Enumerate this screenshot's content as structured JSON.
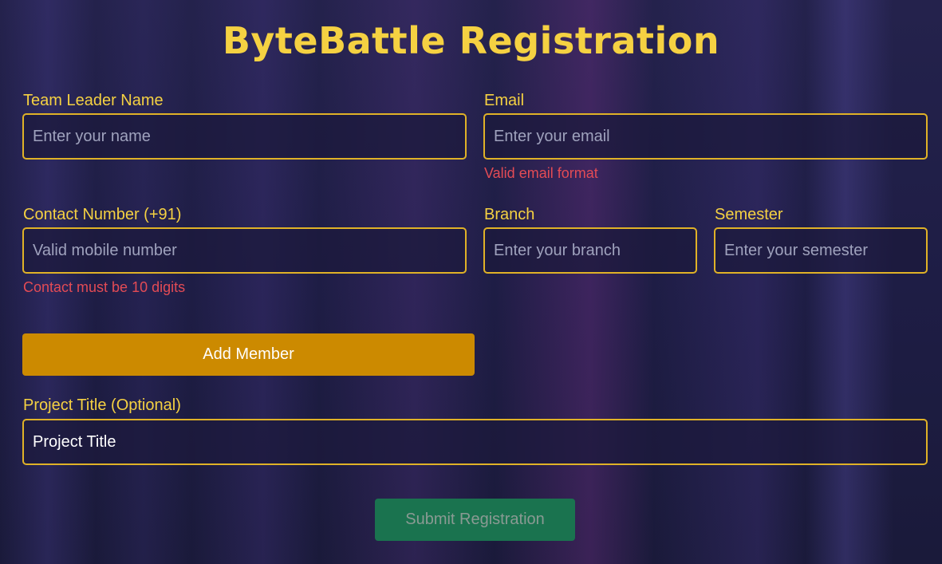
{
  "title": "ByteBattle Registration",
  "fields": {
    "leader_name": {
      "label": "Team Leader Name",
      "placeholder": "Enter your name",
      "value": ""
    },
    "email": {
      "label": "Email",
      "placeholder": "Enter your email",
      "value": "",
      "error": "Valid email format"
    },
    "contact": {
      "label": "Contact Number (+91)",
      "placeholder": "Valid mobile number",
      "value": "",
      "error": "Contact must be 10 digits"
    },
    "branch": {
      "label": "Branch",
      "placeholder": "Enter your branch",
      "value": ""
    },
    "semester": {
      "label": "Semester",
      "placeholder": "Enter your semester",
      "value": ""
    },
    "project_title": {
      "label": "Project Title (Optional)",
      "placeholder": "",
      "value": "Project Title"
    }
  },
  "buttons": {
    "add_member": "Add Member",
    "submit": "Submit Registration"
  },
  "colors": {
    "accent": "#f5d142",
    "border": "#e0b227",
    "error": "#e34b55",
    "add_button": "#cc8a00",
    "submit_button": "#1a734f"
  }
}
